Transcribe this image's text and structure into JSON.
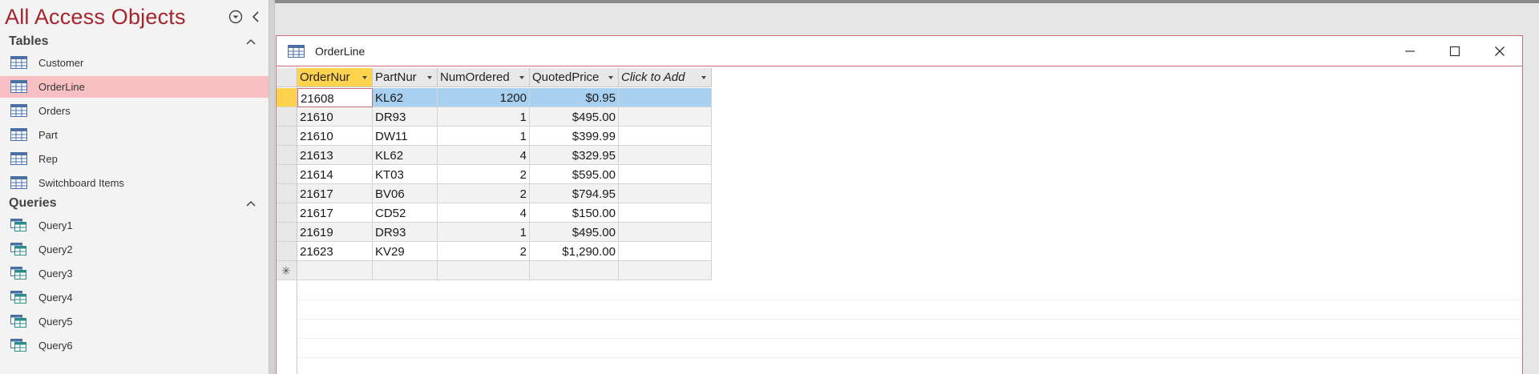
{
  "nav": {
    "title": "All Access Objects",
    "sections": {
      "tables": {
        "label": "Tables",
        "items": [
          "Customer",
          "OrderLine",
          "Orders",
          "Part",
          "Rep",
          "Switchboard Items"
        ],
        "selected": "OrderLine"
      },
      "queries": {
        "label": "Queries",
        "items": [
          "Query1",
          "Query2",
          "Query3",
          "Query4",
          "Query5",
          "Query6"
        ]
      }
    },
    "icons": {
      "menu": "dropdown-circle-icon",
      "collapse": "chevron-left-icon",
      "section_toggle": "chevron-up-icon",
      "table": "table-icon",
      "query": "query-icon"
    }
  },
  "document": {
    "title": "OrderLine",
    "window_buttons": [
      "minimize",
      "maximize",
      "close"
    ]
  },
  "datasheet": {
    "columns": [
      {
        "label": "OrderNur",
        "active": true
      },
      {
        "label": "PartNur",
        "active": false
      },
      {
        "label": "NumOrdered",
        "active": false
      },
      {
        "label": "QuotedPrice",
        "active": false
      },
      {
        "label": "Click to Add",
        "active": false
      }
    ],
    "rows": [
      [
        "21608",
        "KL62",
        "1200",
        "$0.95"
      ],
      [
        "21610",
        "DR93",
        "1",
        "$495.00"
      ],
      [
        "21610",
        "DW11",
        "1",
        "$399.99"
      ],
      [
        "21613",
        "KL62",
        "4",
        "$329.95"
      ],
      [
        "21614",
        "KT03",
        "2",
        "$595.00"
      ],
      [
        "21617",
        "BV06",
        "2",
        "$794.95"
      ],
      [
        "21617",
        "CD52",
        "4",
        "$150.00"
      ],
      [
        "21619",
        "DR93",
        "1",
        "$495.00"
      ],
      [
        "21623",
        "KV29",
        "2",
        "$1,290.00"
      ]
    ],
    "selected_row": 0,
    "new_record_marker": "✳"
  },
  "colors": {
    "accent": "#a4262c",
    "selected_nav": "#f8c0c2",
    "active_header": "#ffd34d",
    "selected_row": "#a8d0f0",
    "window_border": "#c4727a"
  }
}
